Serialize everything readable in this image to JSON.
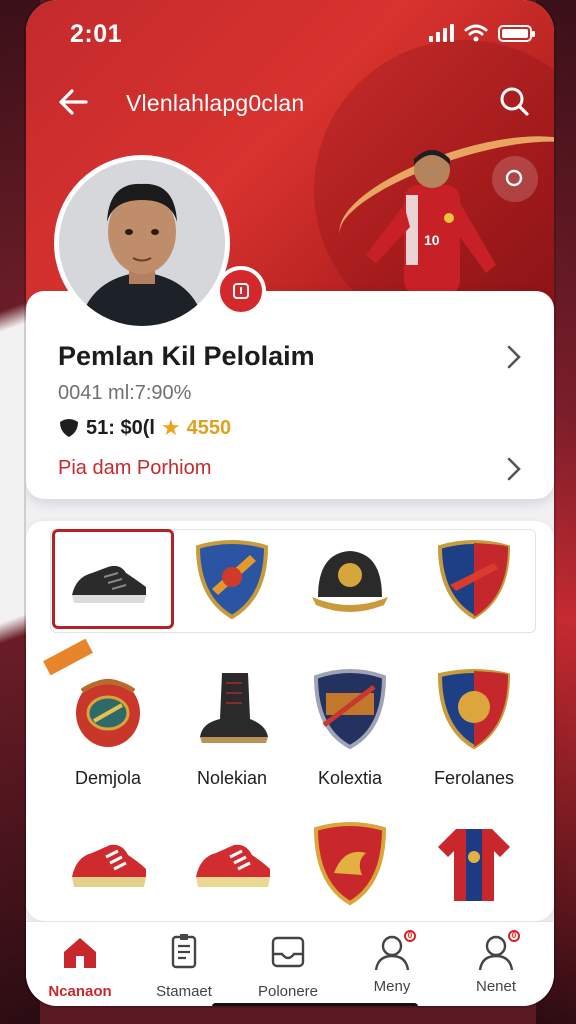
{
  "status_bar": {
    "time": "2:01"
  },
  "header": {
    "title": "Vlenlahlapg0clan"
  },
  "profile": {
    "name": "Pemlan Kil Pelolaim",
    "subtitle": "0041 ml:7:90%",
    "stat_a": "51: $0(l",
    "stat_b": "4550",
    "link_label": "Pia dam Porhiom"
  },
  "items": {
    "row2_labels": [
      "Demjola",
      "Nolekian",
      "Kolextia",
      "Ferolanes"
    ]
  },
  "tabbar": {
    "tabs": [
      {
        "label": "Ncanaon",
        "icon": "home-icon",
        "active": true
      },
      {
        "label": "Stamaet",
        "icon": "document-icon",
        "active": false
      },
      {
        "label": "Polonere",
        "icon": "inbox-icon",
        "active": false
      },
      {
        "label": "Meny",
        "icon": "person-search-icon",
        "active": false,
        "badge": "0"
      },
      {
        "label": "Nenet",
        "icon": "profile-icon",
        "active": false,
        "badge": "0"
      }
    ]
  },
  "colors": {
    "brand_red": "#c8282c",
    "accent_gold": "#e9a61d"
  }
}
